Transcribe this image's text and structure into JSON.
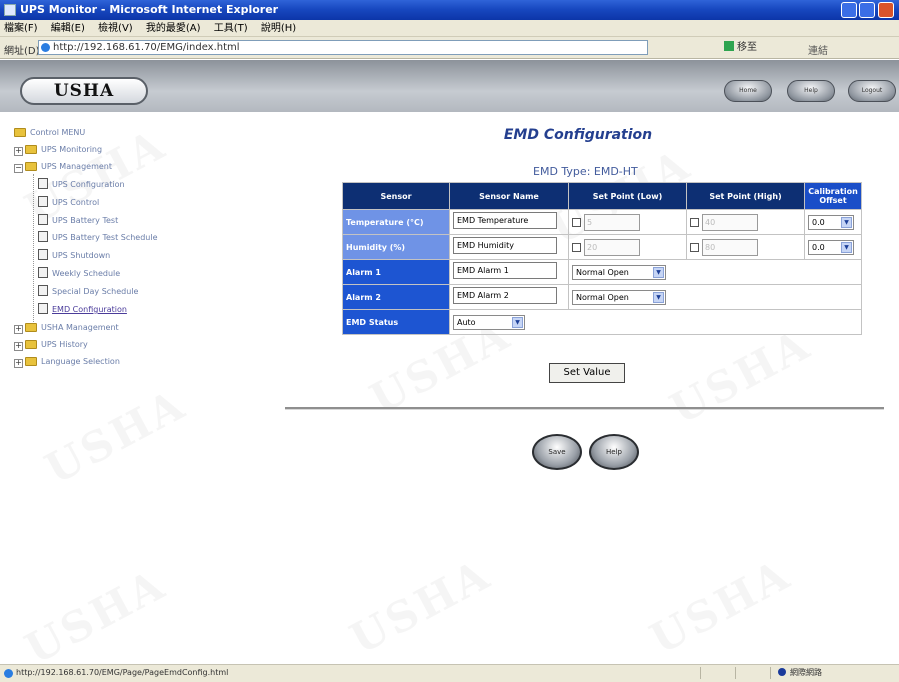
{
  "window": {
    "title": "UPS Monitor - Microsoft Internet Explorer"
  },
  "menubar": [
    "檔案(F)",
    "編輯(E)",
    "檢視(V)",
    "我的最愛(A)",
    "工具(T)",
    "說明(H)"
  ],
  "address": {
    "label": "網址(D)",
    "url": "http://192.168.61.70/EMG/index.html",
    "go_label": "移至",
    "links_label": "連結"
  },
  "header": {
    "logo": "USHA",
    "buttons": [
      "Home",
      "Help",
      "Logout"
    ]
  },
  "sidebar": {
    "root": "Control MENU",
    "items": [
      {
        "label": "UPS Monitoring"
      },
      {
        "label": "UPS Management"
      },
      {
        "label": "UPS Configuration"
      },
      {
        "label": "UPS Control"
      },
      {
        "label": "UPS Battery Test"
      },
      {
        "label": "UPS Battery Test Schedule"
      },
      {
        "label": "UPS Shutdown"
      },
      {
        "label": "Weekly Schedule"
      },
      {
        "label": "Special Day Schedule"
      },
      {
        "label": "EMD Configuration"
      },
      {
        "label": "USHA Management"
      },
      {
        "label": "UPS History"
      },
      {
        "label": "Language Selection"
      }
    ]
  },
  "page": {
    "title": "EMD Configuration",
    "emd_type_label": "EMD Type",
    "emd_type_value": "EMD-HT",
    "columns": [
      "Sensor",
      "Sensor Name",
      "Set Point (Low)",
      "Set Point (High)",
      "Calibration Offset"
    ],
    "rows": {
      "temperature": {
        "label": "Temperature (°C)",
        "name": "EMD Temperature",
        "low": "5",
        "high": "40",
        "offset": "0.0"
      },
      "humidity": {
        "label": "Humidity (%)",
        "name": "EMD Humidity",
        "low": "20",
        "high": "80",
        "offset": "0.0"
      },
      "alarm1": {
        "label": "Alarm 1",
        "name": "EMD Alarm 1",
        "mode": "Normal Open"
      },
      "alarm2": {
        "label": "Alarm 2",
        "name": "EMD Alarm 2",
        "mode": "Normal Open"
      },
      "status": {
        "label": "EMD Status",
        "value": "Auto"
      }
    },
    "set_value_button": "Set Value",
    "bottom_buttons": [
      "Save",
      "Help"
    ]
  },
  "statusbar": {
    "url": "http://192.168.61.70/EMG/Page/PageEmdConfig.html",
    "zone": "網際網路"
  },
  "colors": {
    "header_navy": "#0d2f73",
    "row_blue": "#1d55d2",
    "title_blue": "#243f8f"
  }
}
